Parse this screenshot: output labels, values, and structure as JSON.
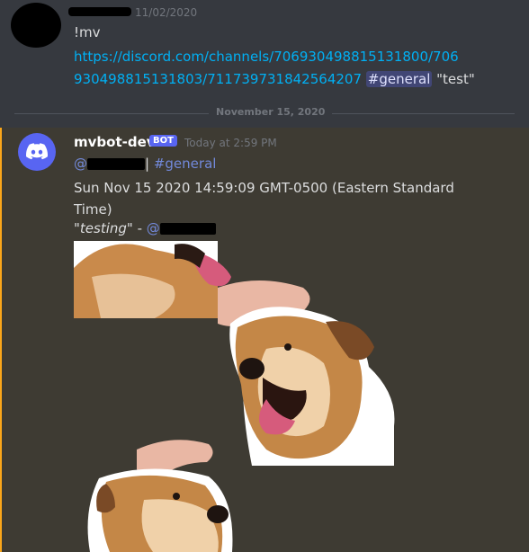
{
  "message1": {
    "timestamp": "11/02/2020",
    "command": "!mv",
    "link_line1": "https://discord.com/channels/706930498815131800/706",
    "link_line2": "930498815131803/711739731842564207",
    "channel_mention": "#general",
    "quoted_text": "\"test\""
  },
  "divider": {
    "label": "November 15, 2020"
  },
  "message2": {
    "username": "mvbot-dev",
    "bot_tag": "BOT",
    "timestamp": "Today at 2:59 PM",
    "at_symbol": "@",
    "pipe": "|",
    "channel": "#general",
    "datetime": "Sun Nov 15 2020 14:59:09 GMT-0500 (Eastern Standard Time)",
    "quote": "\"testing\"",
    "dash": " - ",
    "at_symbol2": "@"
  },
  "colors": {
    "background": "#36393f",
    "link": "#00b0f4",
    "mention": "#7289da",
    "bot_tag": "#5865f2",
    "highlight_bar": "#faa61a"
  },
  "icons": {
    "bot_avatar": "discord-logo-icon"
  }
}
